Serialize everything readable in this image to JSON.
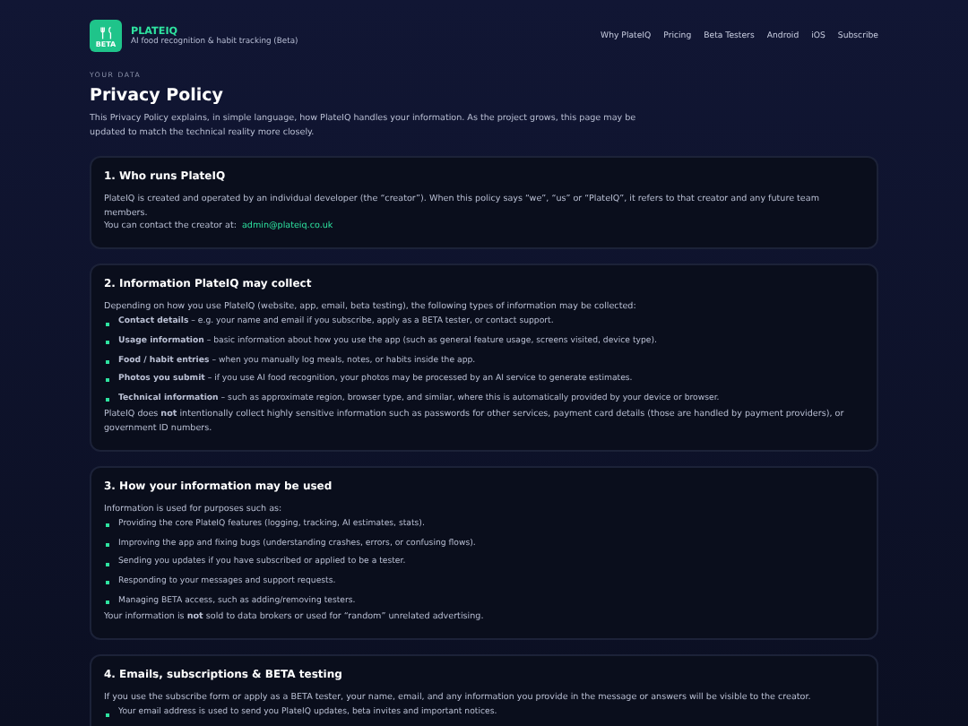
{
  "header": {
    "brand": "PLATEIQ",
    "tagline": "AI food recognition & habit tracking (Beta)",
    "logo_badge": "BETA",
    "nav": [
      {
        "label": "Why PlateIQ"
      },
      {
        "label": "Pricing"
      },
      {
        "label": "Beta Testers"
      },
      {
        "label": "Android"
      },
      {
        "label": "iOS"
      },
      {
        "label": "Subscribe"
      }
    ]
  },
  "eyebrow": "YOUR DATA",
  "title": "Privacy Policy",
  "intro": "This Privacy Policy explains, in simple language, how PlateIQ handles your information. As the project grows, this page may be updated to match the technical reality more closely.",
  "sections": [
    {
      "heading": "1. Who runs PlateIQ",
      "blocks": [
        {
          "kind": "p",
          "text": "PlateIQ is created and operated by an individual developer (the “creator”). When this policy says “we”, “us” or “PlateIQ”, it refers to that creator and any future team members."
        },
        {
          "kind": "contact",
          "text": "You can contact the creator at:",
          "link": "admin@plateiq.co.uk"
        }
      ]
    },
    {
      "heading": "2. Information PlateIQ may collect",
      "blocks": [
        {
          "kind": "p",
          "text": "Depending on how you use PlateIQ (website, app, email, beta testing), the following types of information may be collected:"
        },
        {
          "kind": "li",
          "text": "**Contact details** – e.g. your name and email if you subscribe, apply as a BETA tester, or contact support."
        },
        {
          "kind": "li",
          "text": "**Usage information** – basic information about how you use the app (such as general feature usage, screens visited, device type)."
        },
        {
          "kind": "li",
          "text": "**Food / habit entries** – when you manually log meals, notes, or habits inside the app."
        },
        {
          "kind": "li",
          "text": "**Photos you submit** – if you use AI food recognition, your photos may be processed by an AI service to generate estimates."
        },
        {
          "kind": "li",
          "text": "**Technical information** – such as approximate region, browser type, and similar, where this is automatically provided by your device or browser."
        },
        {
          "kind": "p",
          "text": "PlateIQ does **not** intentionally collect highly sensitive information such as passwords for other services, payment card details (those are handled by payment providers), or government ID numbers."
        }
      ]
    },
    {
      "heading": "3. How your information may be used",
      "blocks": [
        {
          "kind": "p",
          "text": "Information is used for purposes such as:"
        },
        {
          "kind": "li",
          "text": "Providing the core PlateIQ features (logging, tracking, AI estimates, stats)."
        },
        {
          "kind": "li",
          "text": "Improving the app and fixing bugs (understanding crashes, errors, or confusing flows)."
        },
        {
          "kind": "li",
          "text": "Sending you updates if you have subscribed or applied to be a tester."
        },
        {
          "kind": "li",
          "text": "Responding to your messages and support requests."
        },
        {
          "kind": "li",
          "text": "Managing BETA access, such as adding/removing testers."
        },
        {
          "kind": "p",
          "text": "Your information is **not** sold to data brokers or used for “random” unrelated advertising."
        }
      ]
    },
    {
      "heading": "4. Emails, subscriptions & BETA testing",
      "blocks": [
        {
          "kind": "p",
          "text": "If you use the subscribe form or apply as a BETA tester, your name, email, and any information you provide in the message or answers will be visible to the creator."
        },
        {
          "kind": "li",
          "text": "Your email address is used to send you PlateIQ updates, beta invites and important notices."
        }
      ]
    }
  ]
}
